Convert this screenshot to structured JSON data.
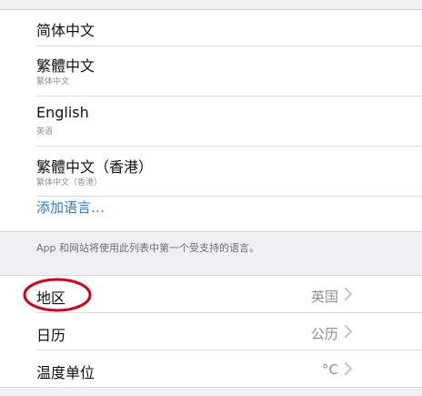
{
  "languages": [
    {
      "title": "简体中文",
      "subtitle": ""
    },
    {
      "title": "繁體中文",
      "subtitle": "繁体中文"
    },
    {
      "title": "English",
      "subtitle": "英语"
    },
    {
      "title": "繁體中文（香港）",
      "subtitle": "繁体中文（香港）"
    }
  ],
  "add_language_label": "添加语言…",
  "footer_note": "App 和网站将使用此列表中第一个受支持的语言。",
  "settings": [
    {
      "label": "地区",
      "value": "英国"
    },
    {
      "label": "日历",
      "value": "公历"
    },
    {
      "label": "温度单位",
      "value": "°C"
    }
  ],
  "colors": {
    "link": "#2a7bd6",
    "annotation": "#d0021b",
    "background": "#efeff4"
  },
  "icons": {
    "chevron": "chevron-right-icon"
  }
}
